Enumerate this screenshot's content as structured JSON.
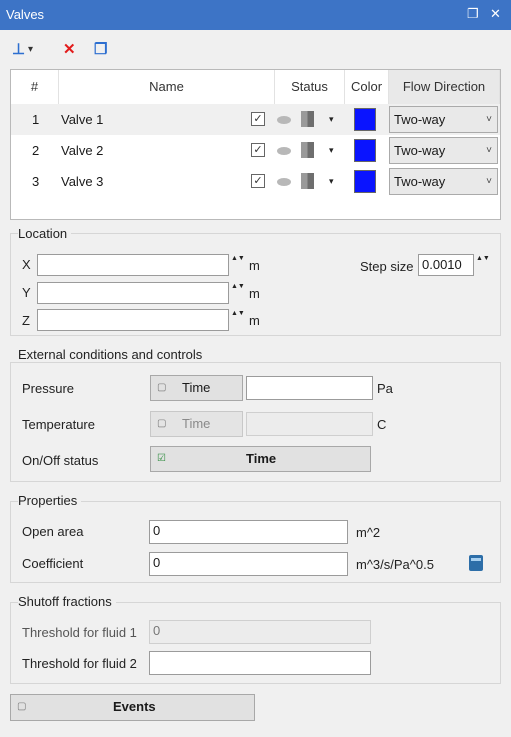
{
  "window": {
    "title": "Valves",
    "restore_glyph": "❐",
    "close_glyph": "✕"
  },
  "toolbar": {
    "add_glyph": "⊥",
    "add_arrow": "▾",
    "delete_glyph": "✕",
    "copy_glyph": "❐"
  },
  "table": {
    "headers": [
      "#",
      "Name",
      "Status",
      "Color",
      "Flow Direction"
    ],
    "rows": [
      {
        "index": "1",
        "name": "Valve 1",
        "checked": "✓",
        "color": "#0a14ff",
        "flow": "Two-way"
      },
      {
        "index": "2",
        "name": "Valve 2",
        "checked": "✓",
        "color": "#0a14ff",
        "flow": "Two-way"
      },
      {
        "index": "3",
        "name": "Valve 3",
        "checked": "✓",
        "color": "#0a14ff",
        "flow": "Two-way"
      }
    ],
    "dropdown_glyph": "▾",
    "chev_glyph": "˅"
  },
  "location": {
    "title": "Location",
    "x_label": "X",
    "y_label": "Y",
    "z_label": "Z",
    "x_value": "",
    "y_value": "",
    "z_value": "",
    "unit": "m",
    "step_label": "Step size",
    "step_value": "0.0010",
    "spin_glyph": "▲▼"
  },
  "external": {
    "title": "External conditions and controls",
    "pressure_label": "Pressure",
    "pressure_btn": "Time",
    "pressure_value": "",
    "pressure_unit": "Pa",
    "temperature_label": "Temperature",
    "temperature_btn": "Time",
    "temperature_value": "",
    "temperature_unit": "C",
    "onoff_label": "On/Off status",
    "onoff_btn": "Time",
    "unchecked_glyph": "▢",
    "checked_glyph": "☑"
  },
  "properties": {
    "title": "Properties",
    "open_area_label": "Open area",
    "open_area_value": "0",
    "open_area_unit": "m^2",
    "coef_label": "Coefficient",
    "coef_value": "0",
    "coef_unit": "m^3/s/Pa^0.5"
  },
  "shutoff": {
    "title": "Shutoff fractions",
    "fluid1_label": "Threshold for fluid 1",
    "fluid1_value": "0",
    "fluid2_label": "Threshold for fluid 2",
    "fluid2_value": ""
  },
  "events": {
    "label": "Events"
  }
}
